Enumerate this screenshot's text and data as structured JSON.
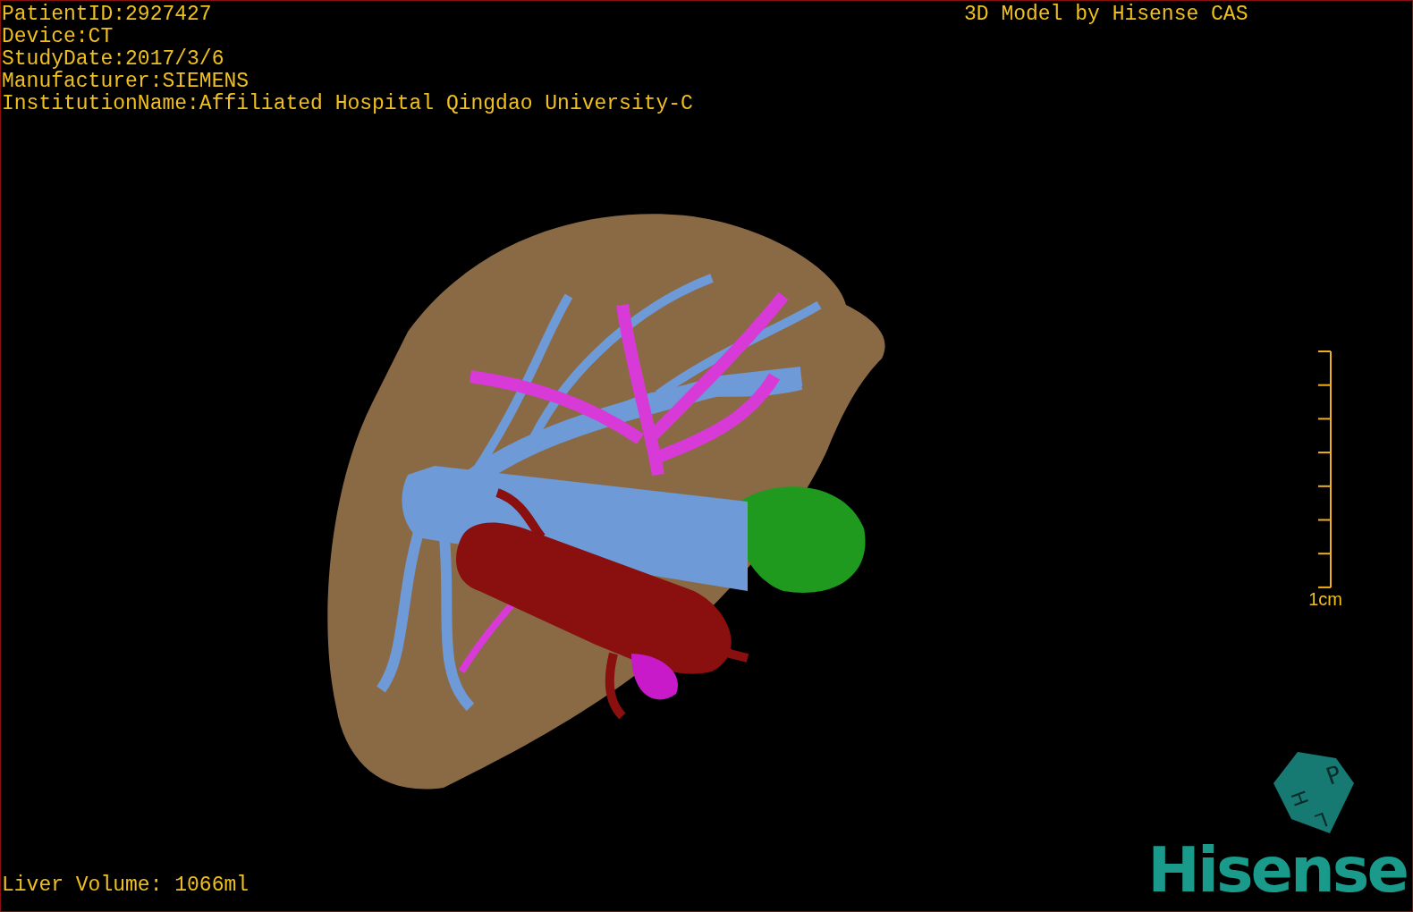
{
  "info_lines": [
    "PatientID:2927427",
    "Device:CT",
    "StudyDate:2017/3/6",
    "Manufacturer:SIEMENS",
    "InstitutionName:Affiliated Hospital Qingdao University-C"
  ],
  "credit": "3D Model by Hisense CAS",
  "scale_bar": {
    "label": "1cm"
  },
  "orientation_cube": {
    "faces": [
      "P",
      "H",
      "L"
    ]
  },
  "volume": "Liver Volume: 1066ml",
  "logo": "Hisense"
}
